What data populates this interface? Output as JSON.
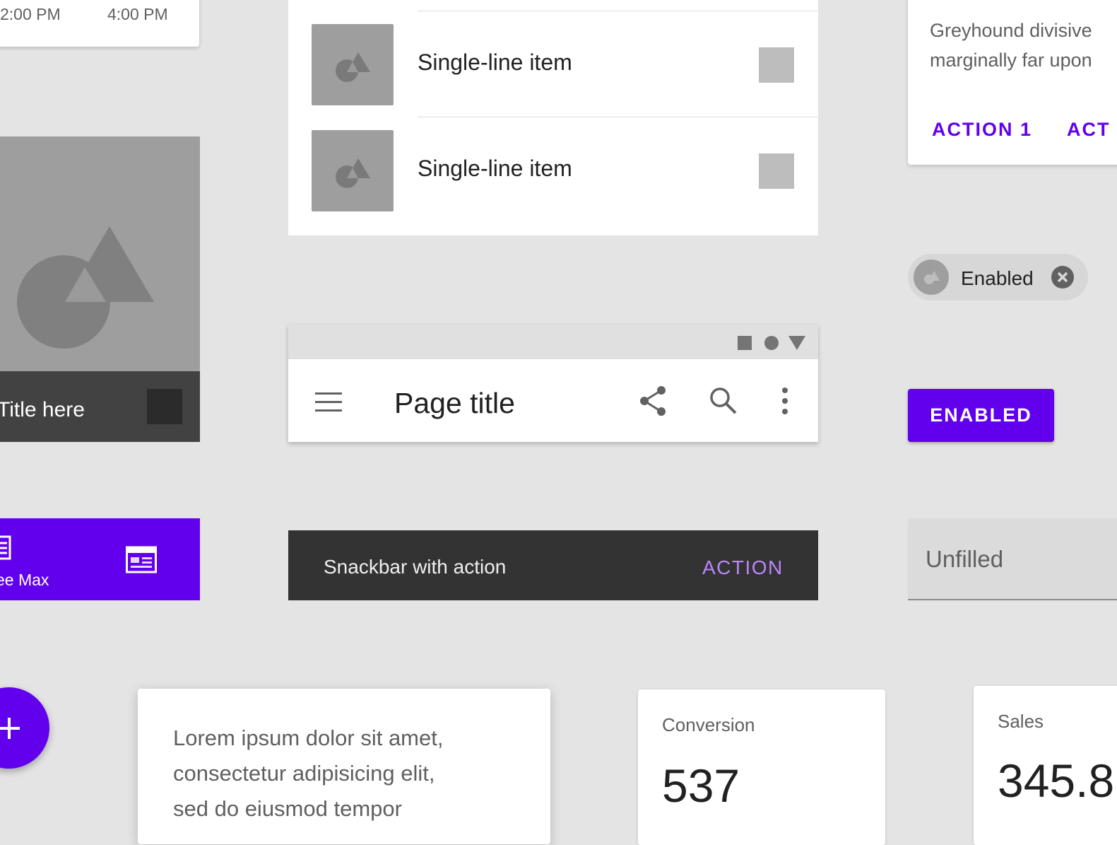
{
  "time_picker": {
    "start": "2:00 PM",
    "end": "4:00 PM"
  },
  "image_tile": {
    "title": "Title here"
  },
  "bottom_nav": {
    "item_label": "ee Max"
  },
  "list": {
    "items": [
      {
        "label": "Single-line item"
      },
      {
        "label": "Single-line item"
      }
    ]
  },
  "app_bar": {
    "title": "Page title"
  },
  "snackbar": {
    "message": "Snackbar with action",
    "action": "ACTION"
  },
  "card": {
    "lines": [
      "Greyhound divisive",
      "marginally far upon"
    ],
    "actions": [
      "ACTION 1",
      "ACT"
    ]
  },
  "chip": {
    "label": "Enabled"
  },
  "button": {
    "label": "ENABLED"
  },
  "text_field": {
    "placeholder": "Unfilled"
  },
  "lorem": {
    "lines": [
      "Lorem ipsum dolor sit amet,",
      "consectetur adipisicing elit,",
      "sed do eiusmod tempor"
    ]
  },
  "stats": {
    "conversion": {
      "label": "Conversion",
      "value": "537"
    },
    "sales": {
      "label": "Sales",
      "value": "345.8"
    }
  },
  "colors": {
    "primary": "#6200ee",
    "snackbar_action": "#bb86fc",
    "surface": "#ffffff",
    "background": "#e4e4e4"
  }
}
